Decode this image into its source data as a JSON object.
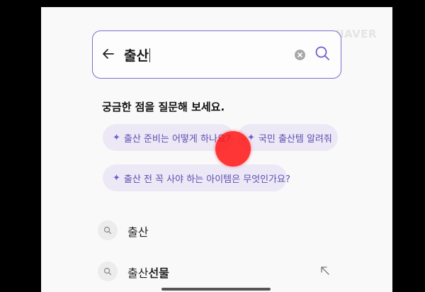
{
  "watermark": "NAVER",
  "search": {
    "query": "출산"
  },
  "prompt_heading": "궁금한 점을 질문해 보세요.",
  "chips": [
    {
      "icon": "sparkle-icon",
      "label": "출산 준비는 어떻게 하나요?"
    },
    {
      "icon": "sparkle-icon",
      "label": "국민 출산템 알려줘"
    },
    {
      "icon": "sparkle-icon",
      "label": "출산 전 꼭 사야 하는 아이템은 무엇인가요?"
    }
  ],
  "suggestions": [
    {
      "prefix": "출산",
      "suffix": ""
    },
    {
      "prefix": "출산",
      "suffix": "선물"
    }
  ],
  "colors": {
    "accent": "#7d6ccf",
    "chip_bg": "#ece8f6",
    "chip_text": "#5a4fb0",
    "touch_indicator": "#ff1414"
  }
}
